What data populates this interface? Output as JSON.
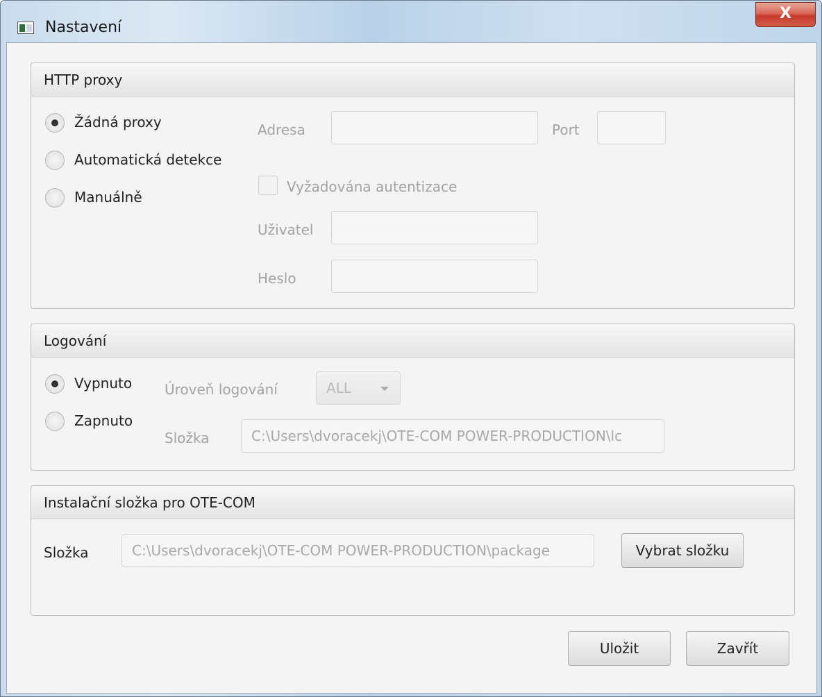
{
  "window": {
    "title": "Nastavení",
    "close_glyph": "X",
    "icon": "app-window-icon"
  },
  "proxy": {
    "header": "HTTP proxy",
    "options": [
      "Žádná proxy",
      "Automatická detekce",
      "Manuálně"
    ],
    "selected": "Žádná proxy",
    "address_label": "Adresa",
    "address_value": "",
    "port_label": "Port",
    "port_value": "",
    "auth_label": "Vyžadována autentizace",
    "auth_checked": false,
    "user_label": "Uživatel",
    "user_value": "",
    "password_label": "Heslo",
    "password_value": ""
  },
  "logging": {
    "header": "Logování",
    "options": [
      "Vypnuto",
      "Zapnuto"
    ],
    "selected": "Vypnuto",
    "level_label": "Úroveň logování",
    "level_value": "ALL",
    "folder_label": "Složka",
    "folder_value": "C:\\Users\\dvoracekj\\OTE-COM POWER-PRODUCTION\\lc"
  },
  "install": {
    "header": "Instalační složka pro OTE-COM",
    "folder_label": "Složka",
    "folder_value": "C:\\Users\\dvoracekj\\OTE-COM POWER-PRODUCTION\\package",
    "choose_button": "Vybrat složku"
  },
  "footer": {
    "save_button": "Uložit",
    "close_button": "Zavřít"
  }
}
